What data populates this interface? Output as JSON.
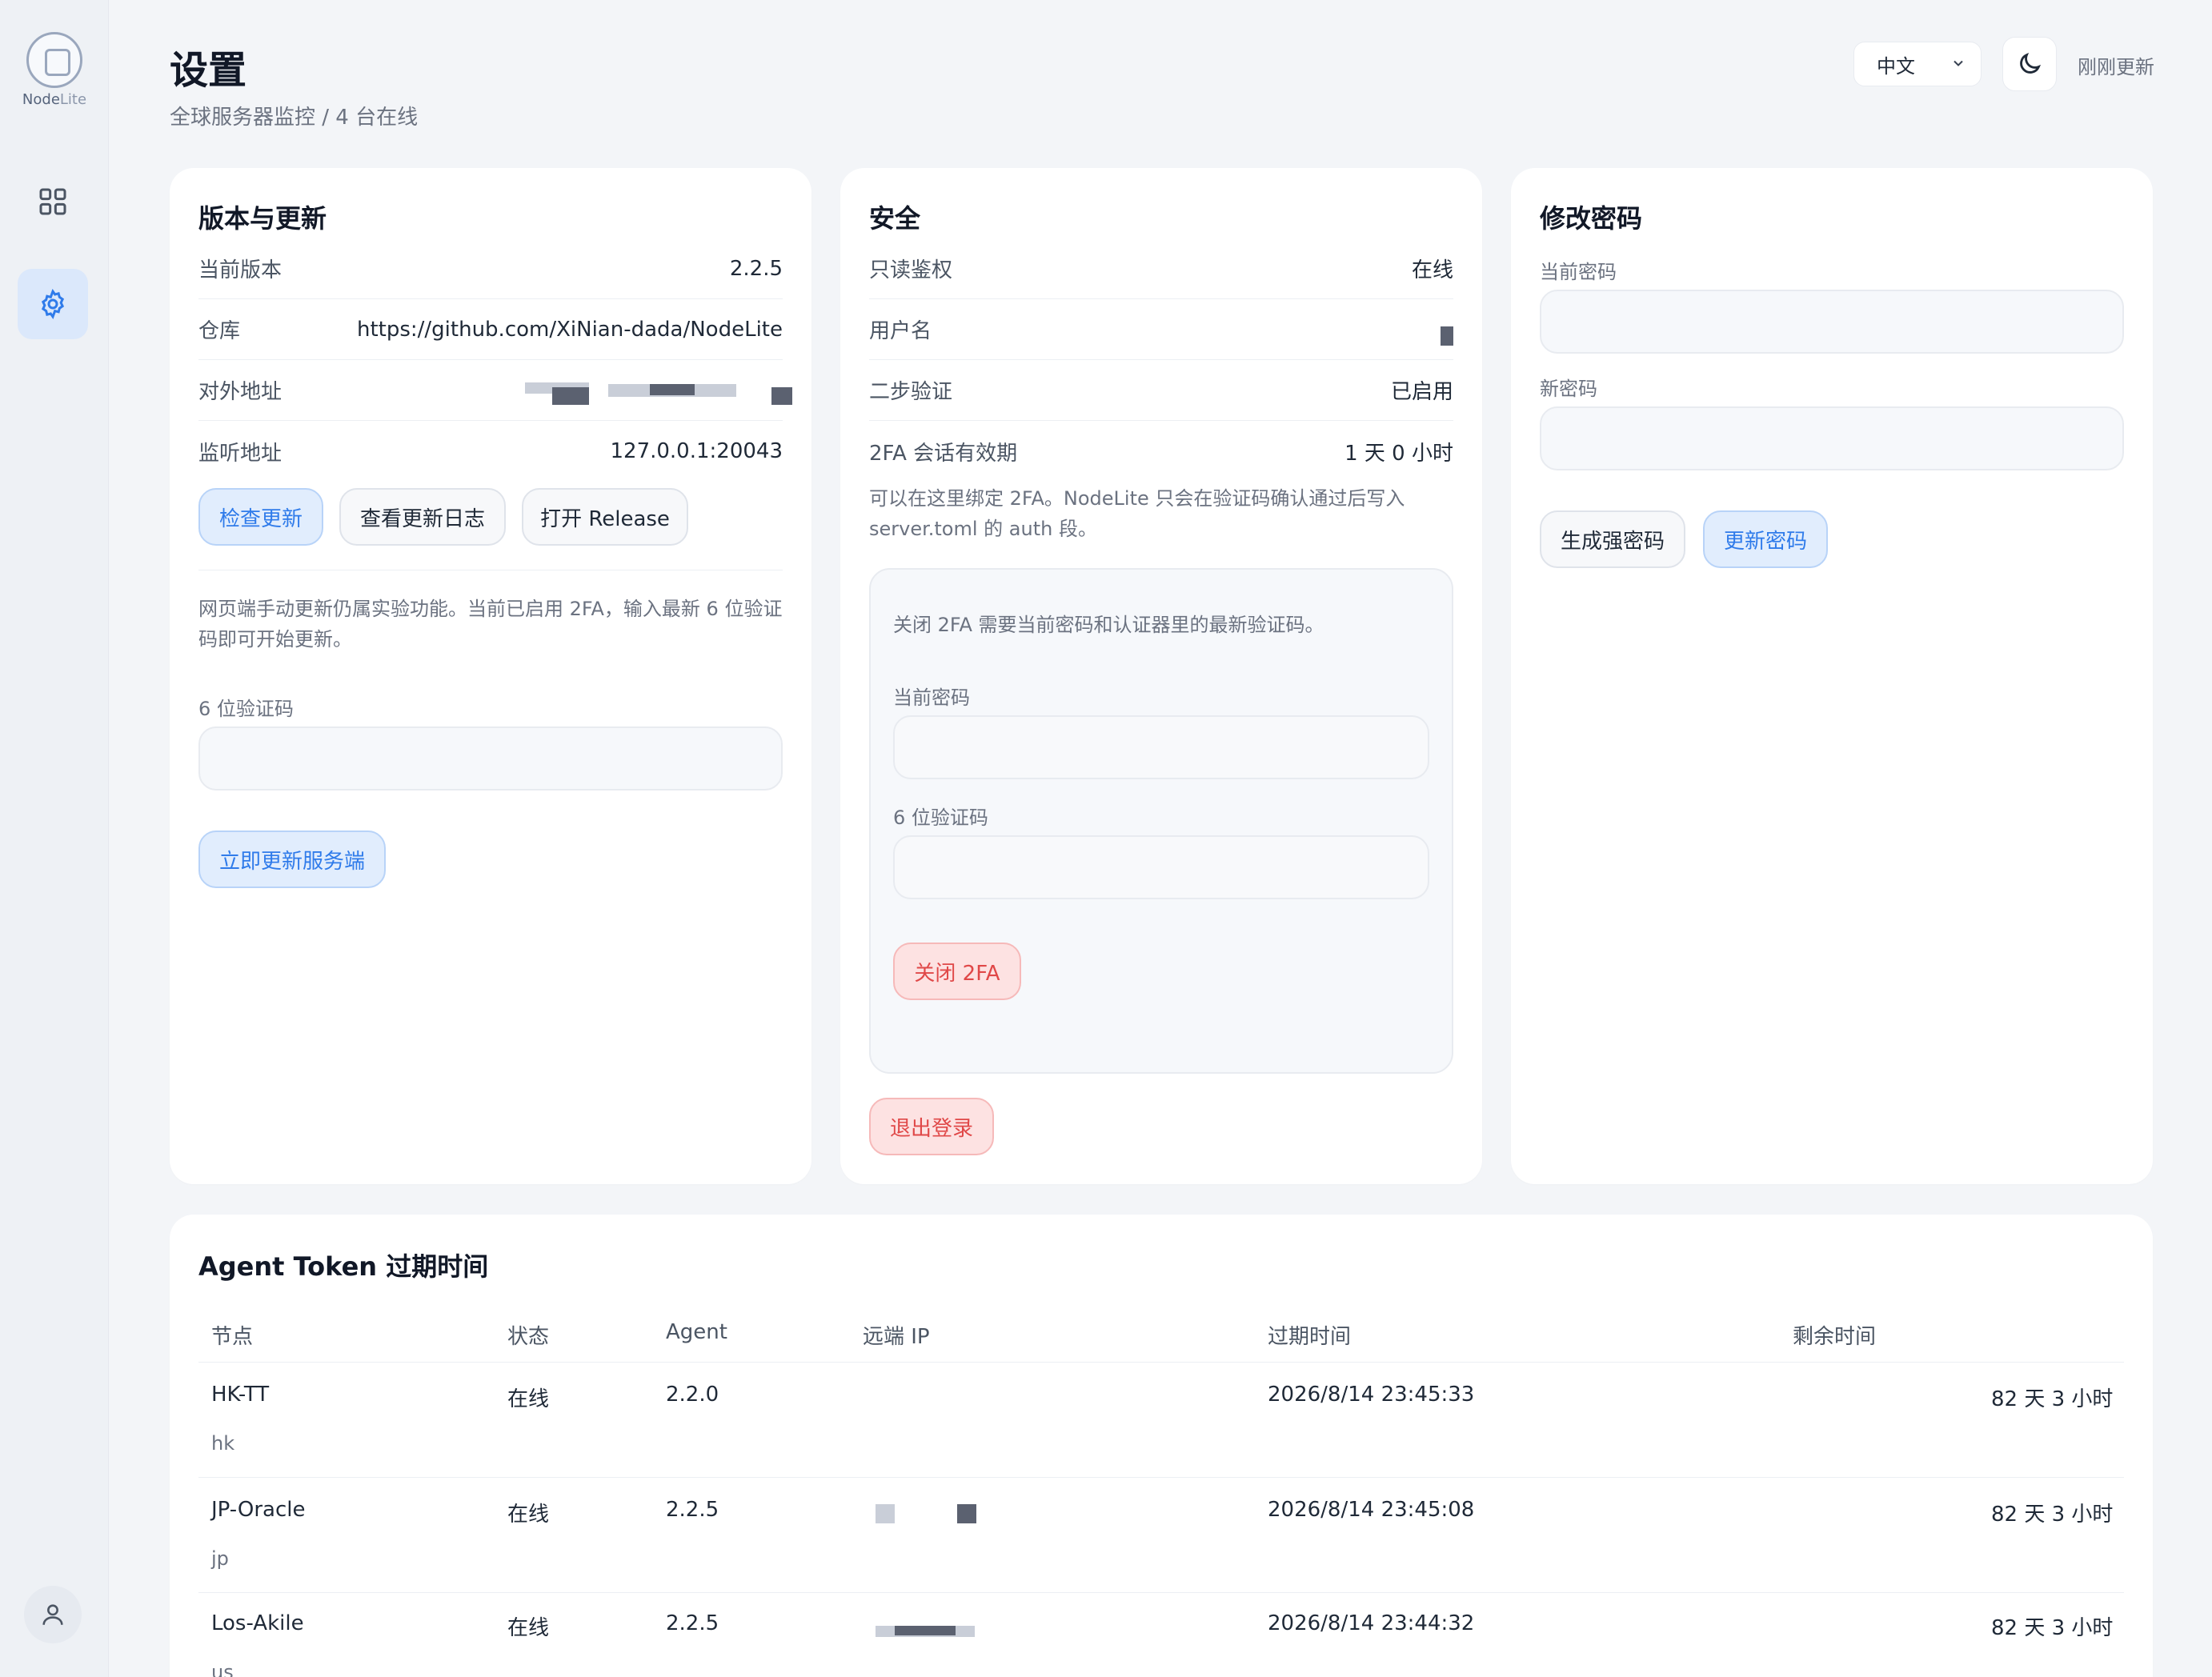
{
  "sidebar": {
    "logo_main": "Node",
    "logo_sub": "Lite",
    "items": [
      {
        "name": "dashboard",
        "icon": "grid-icon"
      },
      {
        "name": "settings",
        "icon": "gear-icon",
        "active": true
      }
    ],
    "bottom_icon": "user-icon"
  },
  "header": {
    "title": "设置",
    "subtitle": "全球服务器监控 / 4 台在线",
    "language": "中文",
    "theme_icon": "moon-icon",
    "updated": "刚刚更新"
  },
  "version_card": {
    "title": "版本与更新",
    "rows": [
      {
        "label": "当前版本",
        "value": "2.2.5"
      },
      {
        "label": "仓库",
        "value": "https://github.com/XiNian-dada/NodeLite"
      },
      {
        "label": "对外地址",
        "value": ""
      },
      {
        "label": "监听地址",
        "value": "127.0.0.1:20043"
      }
    ],
    "buttons": {
      "check": "检查更新",
      "changelog": "查看更新日志",
      "release": "打开 Release"
    },
    "note": "网页端手动更新仍属实验功能。当前已启用 2FA，输入最新 6 位验证码即可开始更新。",
    "code_label": "6 位验证码",
    "update_button": "立即更新服务端"
  },
  "security_card": {
    "title": "安全",
    "rows": [
      {
        "label": "只读鉴权",
        "value": "在线"
      },
      {
        "label": "用户名",
        "value": ""
      },
      {
        "label": "二步验证",
        "value": "已启用"
      },
      {
        "label": "2FA 会话有效期",
        "value": "1 天 0 小时"
      }
    ],
    "note": "可以在这里绑定 2FA。NodeLite 只会在验证码确认通过后写入 server.toml 的 auth 段。",
    "disable_box": {
      "note": "关闭 2FA 需要当前密码和认证器里的最新验证码。",
      "password_label": "当前密码",
      "code_label": "6 位验证码",
      "disable_button": "关闭 2FA"
    },
    "logout_button": "退出登录"
  },
  "password_card": {
    "title": "修改密码",
    "current_label": "当前密码",
    "new_label": "新密码",
    "generate_button": "生成强密码",
    "update_button": "更新密码"
  },
  "token_card": {
    "title": "Agent Token 过期时间",
    "columns": [
      "节点",
      "状态",
      "Agent",
      "远端 IP",
      "过期时间",
      "剩余时间"
    ],
    "rows": [
      {
        "node": "HK-TT",
        "tag": "hk",
        "status": "在线",
        "agent": "2.2.0",
        "ip": "",
        "expires": "2026/8/14 23:45:33",
        "remaining": "82 天 3 小时"
      },
      {
        "node": "JP-Oracle",
        "tag": "jp",
        "status": "在线",
        "agent": "2.2.5",
        "ip": "",
        "expires": "2026/8/14 23:45:08",
        "remaining": "82 天 3 小时"
      },
      {
        "node": "Los-Akile",
        "tag": "us",
        "status": "在线",
        "agent": "2.2.5",
        "ip": "",
        "expires": "2026/8/14 23:44:32",
        "remaining": "82 天 3 小时"
      }
    ]
  },
  "colors": {
    "accent": "#2f7bea",
    "danger": "#e04848",
    "background": "#f3f5f8"
  }
}
